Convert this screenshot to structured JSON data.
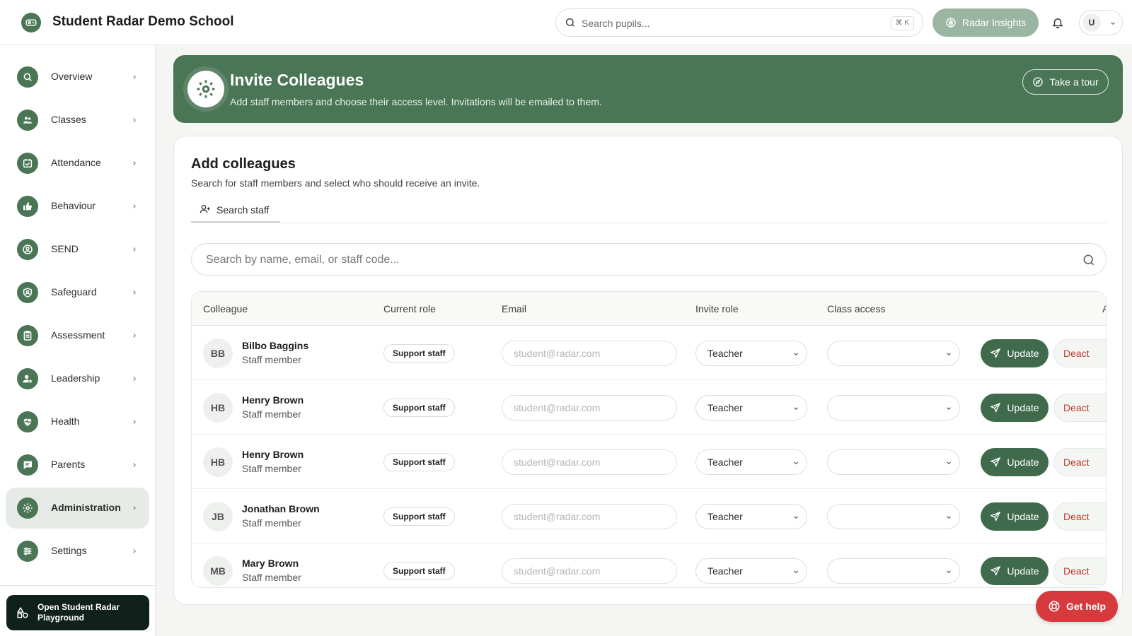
{
  "app": {
    "school_name": "Student Radar Demo School",
    "accent_color": "#4a7656"
  },
  "topbar": {
    "search_placeholder": "Search pupils...",
    "search_shortcut": "⌘ K",
    "insights_label": "Radar Insights",
    "user_initial": "U"
  },
  "sidebar": {
    "items": [
      {
        "label": "Overview",
        "icon": "search-icon"
      },
      {
        "label": "Classes",
        "icon": "users-icon"
      },
      {
        "label": "Attendance",
        "icon": "calendar-check-icon"
      },
      {
        "label": "Behaviour",
        "icon": "thumbs-up-icon"
      },
      {
        "label": "SEND",
        "icon": "user-circle-icon"
      },
      {
        "label": "Safeguard",
        "icon": "shield-user-icon"
      },
      {
        "label": "Assessment",
        "icon": "clipboard-icon"
      },
      {
        "label": "Leadership",
        "icon": "user-star-icon"
      },
      {
        "label": "Health",
        "icon": "heart-pulse-icon"
      },
      {
        "label": "Parents",
        "icon": "message-icon"
      },
      {
        "label": "Administration",
        "icon": "gear-icon",
        "active": true
      },
      {
        "label": "Settings",
        "icon": "sliders-icon"
      }
    ],
    "playground_label": "Open Student Radar Playground"
  },
  "banner": {
    "title": "Invite Colleagues",
    "subtitle": "Add staff members and choose their access level. Invitations will be emailed to them.",
    "tour_label": "Take a tour"
  },
  "card": {
    "title": "Add colleagues",
    "subtitle": "Search for staff members and select who should receive an invite.",
    "tab_label": "Search staff",
    "search_placeholder": "Search by name, email, or staff code..."
  },
  "table": {
    "headers": {
      "colleague": "Colleague",
      "current_role": "Current role",
      "email": "Email",
      "invite_role": "Invite role",
      "class_access": "Class access",
      "actions": "A"
    },
    "email_placeholder": "student@radar.com",
    "update_label": "Update",
    "deactivate_label": "Deact",
    "rows": [
      {
        "initials": "BB",
        "name": "Bilbo Baggins",
        "subrole": "Staff member",
        "current_role": "Support staff",
        "invite_role": "Teacher",
        "class_access": ""
      },
      {
        "initials": "HB",
        "name": "Henry Brown",
        "subrole": "Staff member",
        "current_role": "Support staff",
        "invite_role": "Teacher",
        "class_access": ""
      },
      {
        "initials": "HB",
        "name": "Henry Brown",
        "subrole": "Staff member",
        "current_role": "Support staff",
        "invite_role": "Teacher",
        "class_access": ""
      },
      {
        "initials": "JB",
        "name": "Jonathan Brown",
        "subrole": "Staff member",
        "current_role": "Support staff",
        "invite_role": "Teacher",
        "class_access": ""
      },
      {
        "initials": "MB",
        "name": "Mary Brown",
        "subrole": "Staff member",
        "current_role": "Support staff",
        "invite_role": "Teacher",
        "class_access": ""
      }
    ]
  },
  "help": {
    "label": "Get help"
  }
}
